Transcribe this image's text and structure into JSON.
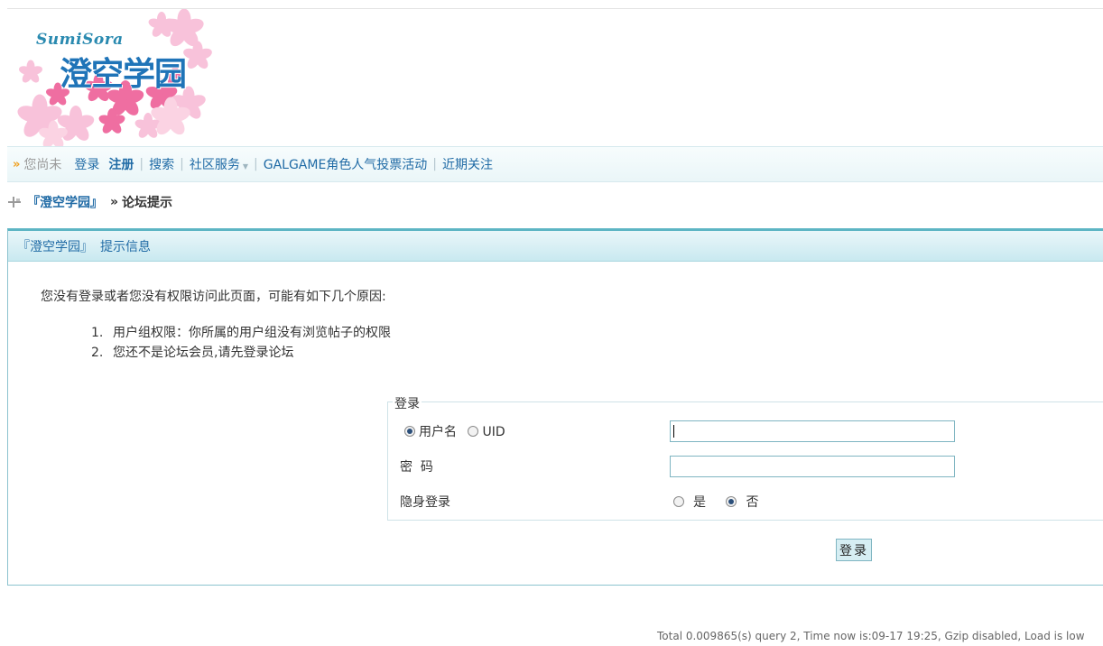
{
  "logo": {
    "script_text": "SumiSora",
    "title": "澄空学园"
  },
  "nav": {
    "guest_text": "您尚未",
    "login": "登录",
    "register": "注册",
    "search": "搜索",
    "community": "社区服务",
    "vote": "GALGAME角色人气投票活动",
    "recent": "近期关注"
  },
  "breadcrumb": {
    "forum": "『澄空学园』",
    "separator": "»",
    "current": "论坛提示"
  },
  "panel": {
    "forum": "『澄空学园』",
    "title": "提示信息",
    "message": "您没有登录或者您没有权限访问此页面，可能有如下几个原因:",
    "reasons": [
      {
        "num": "1.",
        "text": "用户组权限：你所属的用户组没有浏览帖子的权限"
      },
      {
        "num": "2.",
        "text": "您还不是论坛会员,请先登录论坛"
      }
    ]
  },
  "login": {
    "legend": "登录",
    "username_option": "用户名",
    "uid_option": "UID",
    "username_value": "",
    "password_label": "密  码",
    "password_value": "",
    "hidden_label": "隐身登录",
    "hidden_yes": "是",
    "hidden_no": "否",
    "submit": "登录"
  },
  "footer": {
    "text": "Total 0.009865(s) query 2, Time now is:09-17 19:25, Gzip disabled, Load is low"
  },
  "colors": {
    "link": "#1f6aa5",
    "panel_border": "#5db5c4",
    "header_bg": "#c9e9f0"
  }
}
